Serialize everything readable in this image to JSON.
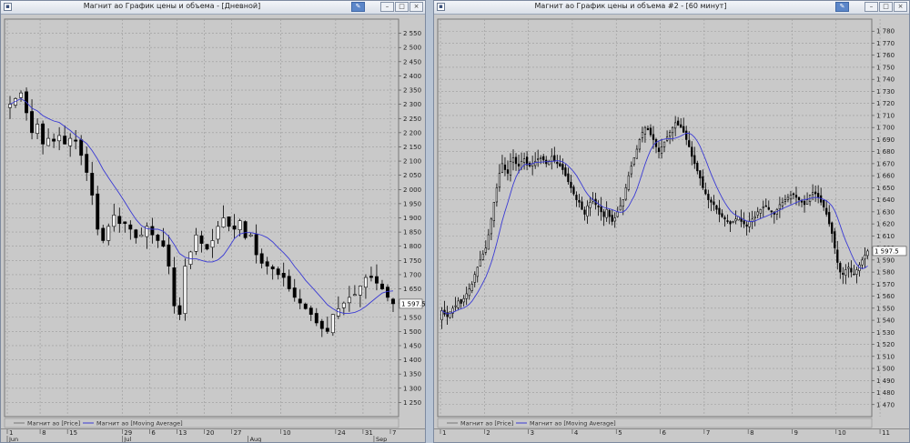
{
  "windows": [
    {
      "title": "Магнит ао График цены и объема - [Дневной]",
      "icons": {
        "system": "chart-window-icon",
        "pin": "pin-icon",
        "minimize": "minimize-icon",
        "maximize": "maximize-icon",
        "close": "close-icon"
      }
    },
    {
      "title": "Магнит ао График цены и объема #2 - [60 минут]",
      "icons": {
        "system": "chart-window-icon",
        "pin": "pin-icon",
        "minimize": "minimize-icon",
        "maximize": "maximize-icon",
        "close": "close-icon"
      }
    }
  ],
  "colors": {
    "background": "#c9c9c9",
    "grid": "#9a9a9a",
    "up_candle": "#ffffff",
    "down_candle": "#000000",
    "moving_average": "#3a3ad4",
    "price_box": "#ffffff"
  },
  "chart_data": [
    {
      "type": "candlestick",
      "title": "Магнит ао График цены и объема - [Дневной]",
      "ylim": [
        1200,
        2600
      ],
      "y_ticks": [
        "2 550",
        "2 500",
        "2 450",
        "2 400",
        "2 350",
        "2 300",
        "2 250",
        "2 200",
        "2 150",
        "2 100",
        "2 050",
        "2 000",
        "1 950",
        "1 900",
        "1 850",
        "1 800",
        "1 750",
        "1 700",
        "1 650",
        "1 600",
        "1 550",
        "1 500",
        "1 450",
        "1 400",
        "1 350",
        "1 300",
        "1 250"
      ],
      "y_tick_values": [
        2550,
        2500,
        2450,
        2400,
        2350,
        2300,
        2250,
        2200,
        2150,
        2100,
        2050,
        2000,
        1950,
        1900,
        1850,
        1800,
        1750,
        1700,
        1650,
        1600,
        1550,
        1500,
        1450,
        1400,
        1350,
        1300,
        1250
      ],
      "x_tick_labels": [
        "1",
        "8",
        "15",
        "29",
        "6",
        "13",
        "20",
        "27",
        "10",
        "24",
        "31",
        "7"
      ],
      "x_tick_index": [
        0,
        6,
        11,
        21,
        26,
        31,
        36,
        41,
        50,
        60,
        65,
        70
      ],
      "month_labels": [
        {
          "label": "Jun",
          "index": 0
        },
        {
          "label": "Jul",
          "index": 21
        },
        {
          "label": "Aug",
          "index": 44
        },
        {
          "label": "Sep",
          "index": 67
        }
      ],
      "last_price": "1 597.5",
      "last_price_value": 1597.5,
      "legend": [
        {
          "name": "Магнит ао [Price]",
          "color": "#777777"
        },
        {
          "name": "Магнит ао [Moving Average]",
          "color": "#3a3ad4"
        }
      ],
      "close": [
        2300,
        2320,
        2340,
        2270,
        2200,
        2230,
        2160,
        2180,
        2170,
        2190,
        2160,
        2180,
        2170,
        2120,
        2060,
        1980,
        1860,
        1820,
        1870,
        1910,
        1880,
        1880,
        1860,
        1830,
        1840,
        1870,
        1840,
        1820,
        1800,
        1730,
        1590,
        1560,
        1730,
        1780,
        1840,
        1810,
        1790,
        1820,
        1870,
        1900,
        1870,
        1860,
        1890,
        1830,
        1840,
        1770,
        1740,
        1730,
        1720,
        1700,
        1690,
        1650,
        1620,
        1600,
        1580,
        1560,
        1530,
        1510,
        1500,
        1560,
        1580,
        1600,
        1620,
        1630,
        1660,
        1690,
        1690,
        1670,
        1650,
        1620,
        1597.5
      ]
    },
    {
      "type": "candlestick",
      "title": "Магнит ао График цены и объема #2 - [60 минут]",
      "ylim": [
        1460,
        1790
      ],
      "y_ticks": [
        "1 780",
        "1 770",
        "1 760",
        "1 750",
        "1 740",
        "1 730",
        "1 720",
        "1 710",
        "1 700",
        "1 690",
        "1 680",
        "1 670",
        "1 660",
        "1 650",
        "1 640",
        "1 630",
        "1 620",
        "1 610",
        "1 600",
        "1 590",
        "1 580",
        "1 570",
        "1 560",
        "1 550",
        "1 540",
        "1 530",
        "1 520",
        "1 510",
        "1 500",
        "1 490",
        "1 480",
        "1 470"
      ],
      "y_tick_values": [
        1780,
        1770,
        1760,
        1750,
        1740,
        1730,
        1720,
        1710,
        1700,
        1690,
        1680,
        1670,
        1660,
        1650,
        1640,
        1630,
        1620,
        1610,
        1600,
        1590,
        1580,
        1570,
        1560,
        1550,
        1540,
        1530,
        1520,
        1510,
        1500,
        1490,
        1480,
        1470
      ],
      "x_tick_labels": [
        "1",
        "2",
        "3",
        "4",
        "5",
        "6",
        "7",
        "8",
        "9",
        "10",
        "11"
      ],
      "x_tick_index": [
        0,
        16,
        32,
        48,
        64,
        80,
        96,
        112,
        128,
        144,
        160
      ],
      "last_price": "1 597.5",
      "last_price_value": 1597.5,
      "legend": [
        {
          "name": "Магнит ао [Price]",
          "color": "#777777"
        },
        {
          "name": "Магнит ао [Moving Average]",
          "color": "#3a3ad4"
        }
      ],
      "close": [
        1548,
        1545,
        1543,
        1547,
        1550,
        1552,
        1556,
        1554,
        1558,
        1562,
        1566,
        1570,
        1578,
        1584,
        1590,
        1595,
        1600,
        1611,
        1624,
        1638,
        1650,
        1662,
        1670,
        1665,
        1662,
        1672,
        1675,
        1670,
        1668,
        1672,
        1674,
        1669,
        1668,
        1670,
        1672,
        1674,
        1675,
        1673,
        1670,
        1672,
        1676,
        1672,
        1670,
        1668,
        1665,
        1660,
        1655,
        1650,
        1645,
        1640,
        1638,
        1632,
        1628,
        1635,
        1638,
        1640,
        1636,
        1634,
        1630,
        1626,
        1632,
        1626,
        1622,
        1625,
        1630,
        1635,
        1640,
        1650,
        1660,
        1668,
        1675,
        1682,
        1690,
        1696,
        1700,
        1698,
        1694,
        1690,
        1684,
        1680,
        1684,
        1688,
        1692,
        1696,
        1700,
        1704,
        1702,
        1700,
        1696,
        1690,
        1684,
        1676,
        1670,
        1664,
        1658,
        1650,
        1645,
        1640,
        1638,
        1636,
        1632,
        1628,
        1626,
        1624,
        1622,
        1620,
        1622,
        1624,
        1626,
        1622,
        1620,
        1618,
        1622,
        1624,
        1626,
        1630,
        1632,
        1634,
        1635,
        1632,
        1630,
        1628,
        1632,
        1636,
        1638,
        1640,
        1642,
        1644,
        1645,
        1642,
        1640,
        1638,
        1636,
        1640,
        1644,
        1646,
        1645,
        1642,
        1638,
        1634,
        1628,
        1620,
        1612,
        1600,
        1588,
        1580,
        1578,
        1582,
        1584,
        1580,
        1578,
        1582,
        1586,
        1590,
        1594,
        1597.5
      ]
    }
  ]
}
